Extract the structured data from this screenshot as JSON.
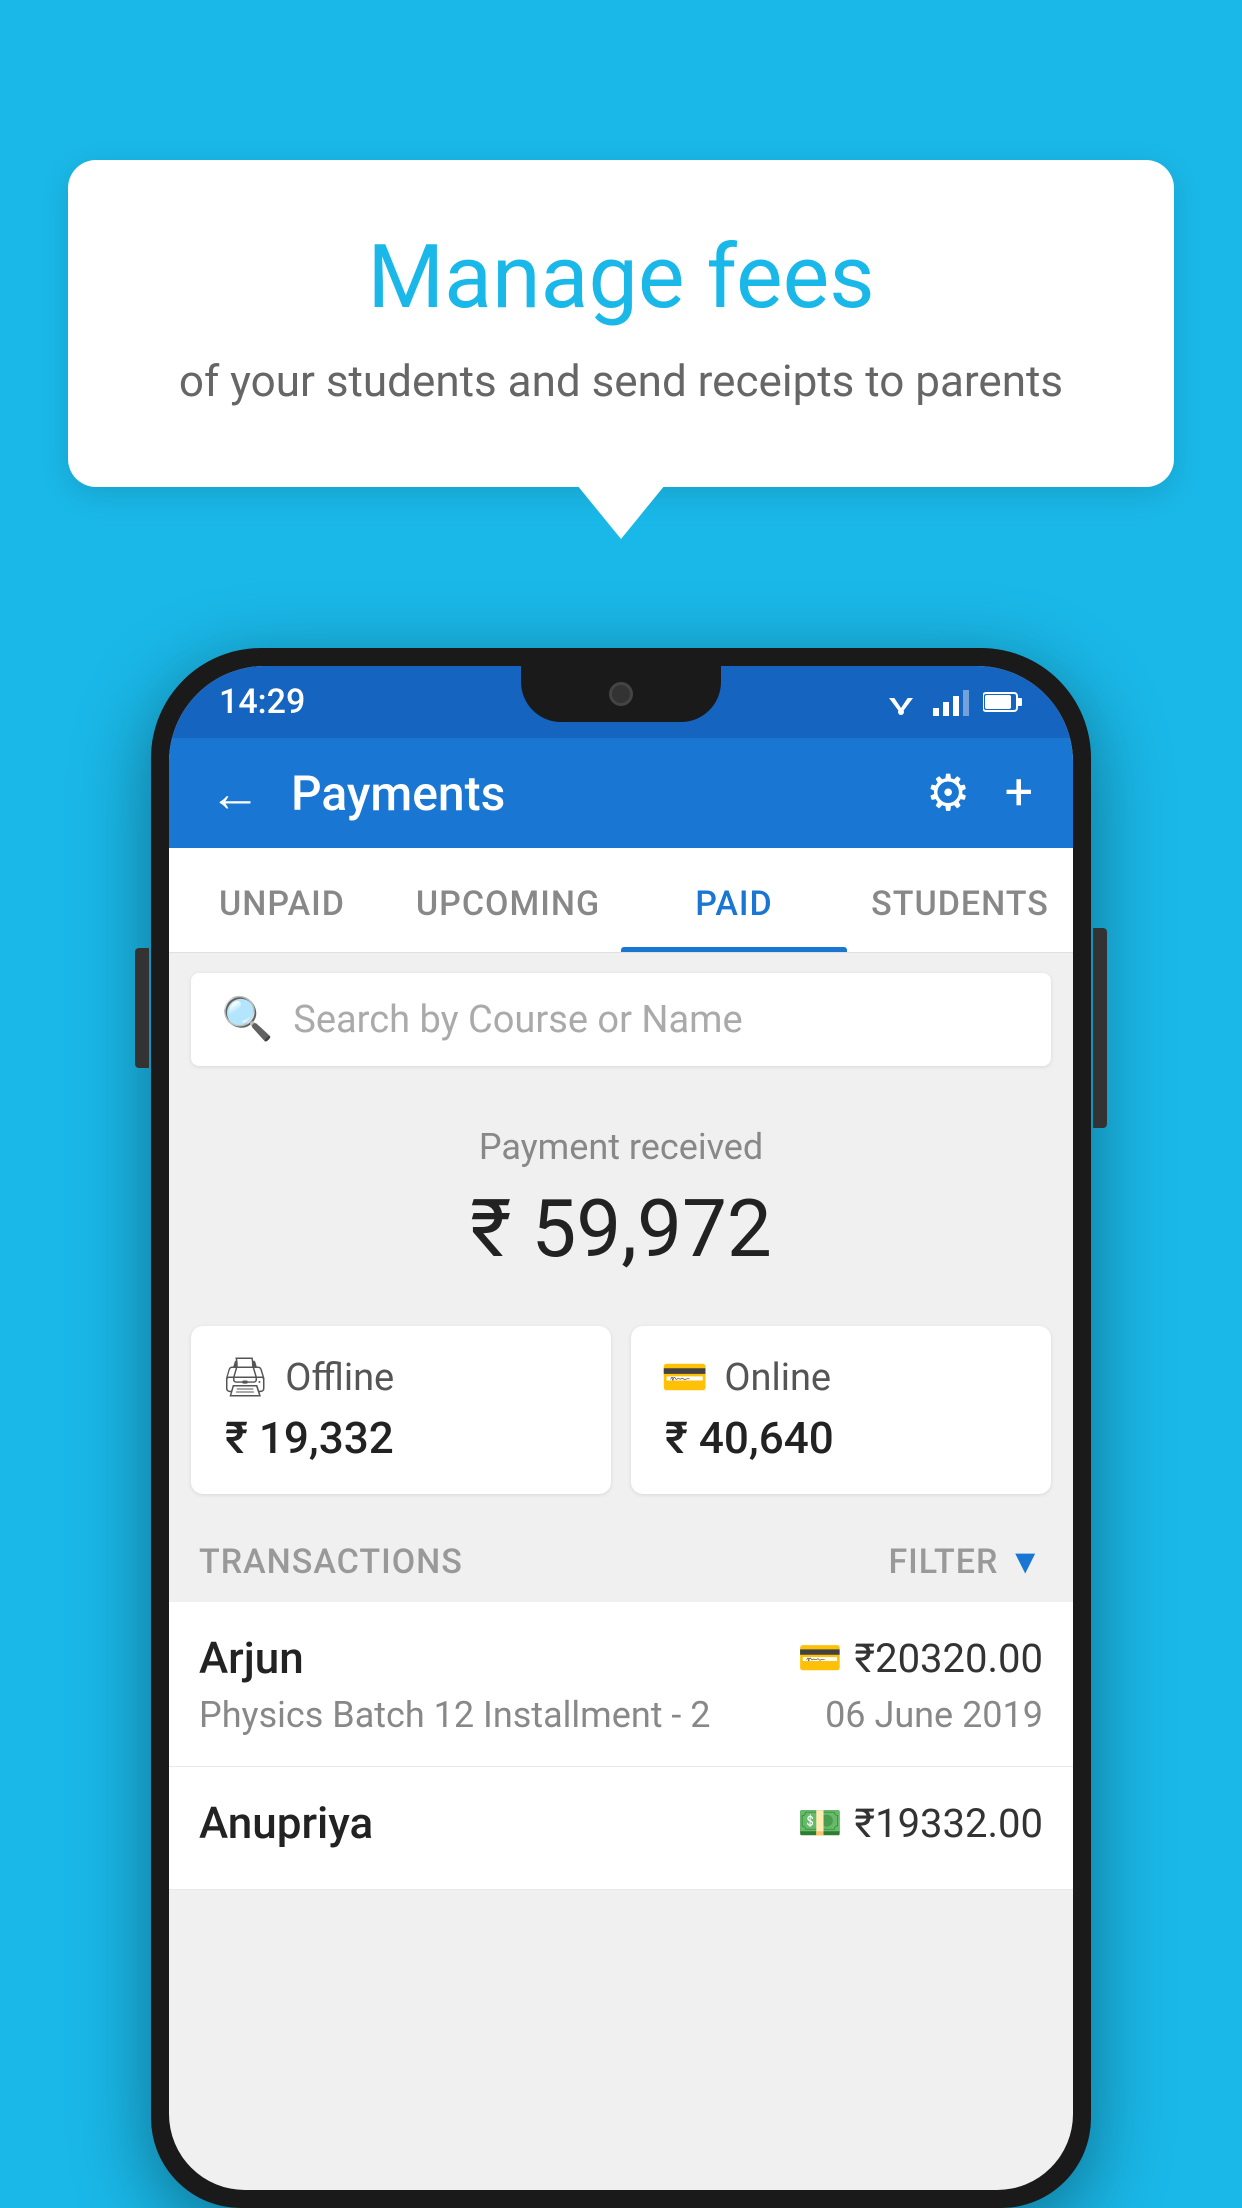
{
  "background_color": "#1AB8E8",
  "bubble": {
    "title": "Manage fees",
    "subtitle": "of your students and send receipts to parents"
  },
  "status_bar": {
    "time": "14:29"
  },
  "app_bar": {
    "title": "Payments",
    "back_label": "←",
    "settings_icon": "⚙",
    "add_icon": "+"
  },
  "tabs": [
    {
      "label": "UNPAID",
      "active": false
    },
    {
      "label": "UPCOMING",
      "active": false
    },
    {
      "label": "PAID",
      "active": true
    },
    {
      "label": "STUDENTS",
      "active": false
    }
  ],
  "search": {
    "placeholder": "Search by Course or Name"
  },
  "payment_received": {
    "label": "Payment received",
    "amount": "₹ 59,972"
  },
  "payment_cards": [
    {
      "icon": "💳",
      "label": "Offline",
      "amount": "₹ 19,332"
    },
    {
      "icon": "🏧",
      "label": "Online",
      "amount": "₹ 40,640"
    }
  ],
  "transactions": {
    "label": "TRANSACTIONS",
    "filter_label": "FILTER"
  },
  "transaction_items": [
    {
      "name": "Arjun",
      "mode_icon": "💳",
      "amount": "₹20320.00",
      "course": "Physics Batch 12 Installment - 2",
      "date": "06 June 2019"
    },
    {
      "name": "Anupriya",
      "mode_icon": "💵",
      "amount": "₹19332.00",
      "course": "",
      "date": ""
    }
  ]
}
